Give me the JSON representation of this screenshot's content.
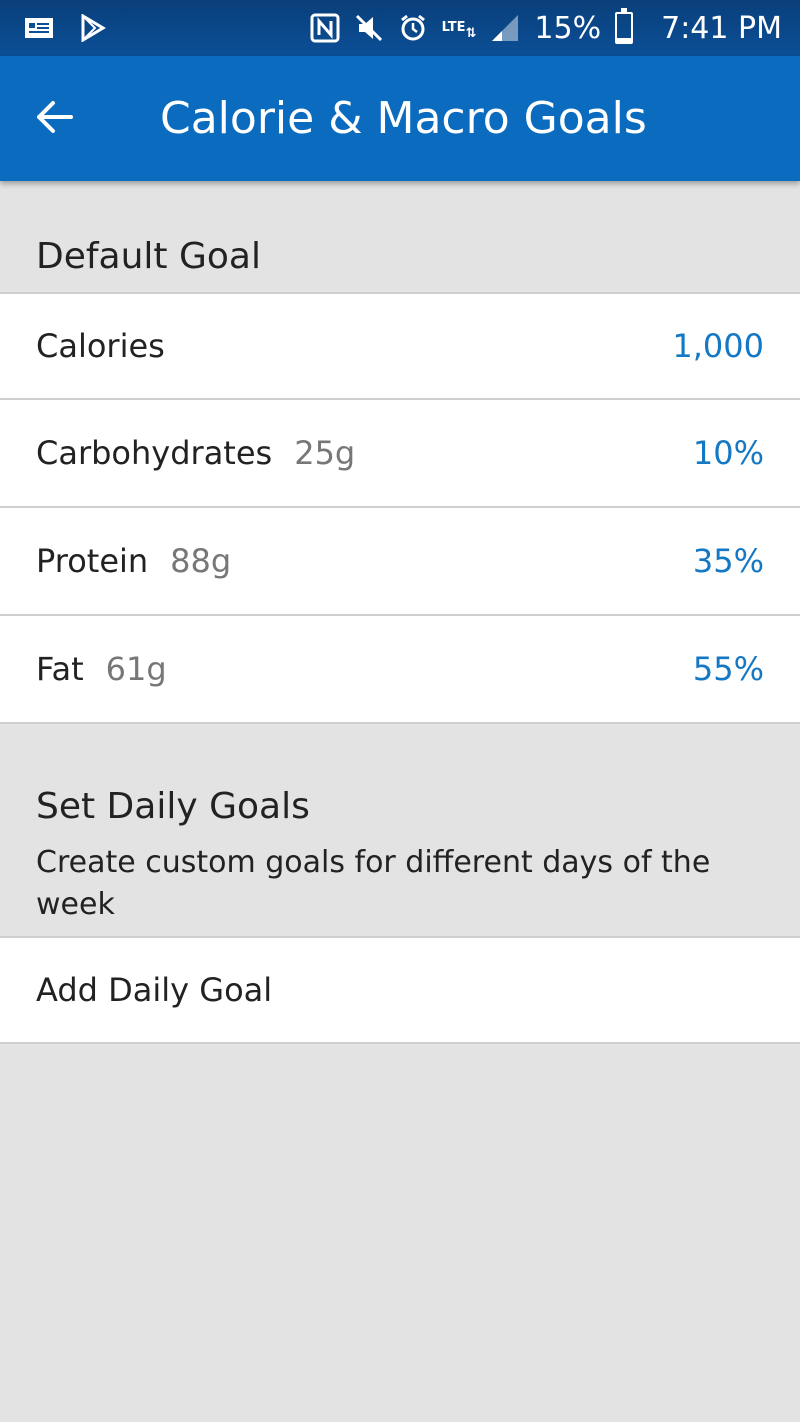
{
  "status_bar": {
    "battery": "15%",
    "battery_level": 0.15,
    "time": "7:41 PM",
    "network": "LTE",
    "icons": [
      "news-icon",
      "play-store-icon",
      "nfc-icon",
      "mute-icon",
      "alarm-icon",
      "lte-icon",
      "signal-icon",
      "battery-icon"
    ]
  },
  "app_bar": {
    "title": "Calorie & Macro Goals",
    "back_icon": "back-arrow-icon"
  },
  "default_goal": {
    "header": "Default Goal",
    "rows": [
      {
        "label": "Calories",
        "sub": "",
        "value": "1,000"
      },
      {
        "label": "Carbohydrates",
        "sub": "25g",
        "value": "10%"
      },
      {
        "label": "Protein",
        "sub": "88g",
        "value": "35%"
      },
      {
        "label": "Fat",
        "sub": "61g",
        "value": "55%"
      }
    ]
  },
  "daily_goals": {
    "header": "Set Daily Goals",
    "description": "Create custom goals for different days of the week",
    "add_label": "Add Daily Goal"
  },
  "colors": {
    "app_bar": "#0b6bbf",
    "accent_value": "#1478c4",
    "background": "#e3e3e3"
  }
}
